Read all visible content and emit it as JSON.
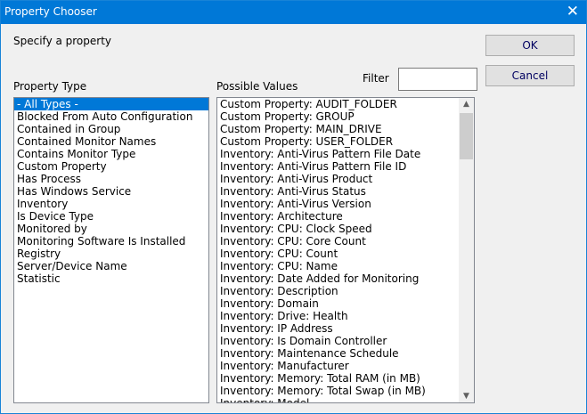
{
  "window": {
    "title": "Property Chooser",
    "close_icon": "close-icon"
  },
  "prompt": "Specify a property",
  "buttons": {
    "ok": "OK",
    "cancel": "Cancel"
  },
  "filter": {
    "label": "Filter",
    "value": ""
  },
  "property_type": {
    "label": "Property Type",
    "selected": "- All Types -",
    "items": [
      "- All Types -",
      "Blocked From Auto Configuration",
      "Contained in Group",
      "Contained Monitor Names",
      "Contains Monitor Type",
      "Custom Property",
      "Has Process",
      "Has Windows Service",
      "Inventory",
      "Is Device Type",
      "Monitored by",
      "Monitoring Software Is Installed",
      "Registry",
      "Server/Device Name",
      "Statistic"
    ]
  },
  "possible_values": {
    "label": "Possible Values",
    "items": [
      "Custom Property: AUDIT_FOLDER",
      "Custom Property: GROUP",
      "Custom Property: MAIN_DRIVE",
      "Custom Property: USER_FOLDER",
      "Inventory: Anti-Virus Pattern File Date",
      "Inventory: Anti-Virus Pattern File ID",
      "Inventory: Anti-Virus Product",
      "Inventory: Anti-Virus Status",
      "Inventory: Anti-Virus Version",
      "Inventory: Architecture",
      "Inventory: CPU: Clock Speed",
      "Inventory: CPU: Core Count",
      "Inventory: CPU: Count",
      "Inventory: CPU: Name",
      "Inventory: Date Added for Monitoring",
      "Inventory: Description",
      "Inventory: Domain",
      "Inventory: Drive: Health",
      "Inventory: IP Address",
      "Inventory: Is Domain Controller",
      "Inventory: Maintenance Schedule",
      "Inventory: Manufacturer",
      "Inventory: Memory: Total RAM (in MB)",
      "Inventory: Memory: Total Swap (in MB)",
      "Inventory: Model"
    ]
  },
  "colors": {
    "title_bar": "#0078d7",
    "selection": "#0078d7"
  }
}
